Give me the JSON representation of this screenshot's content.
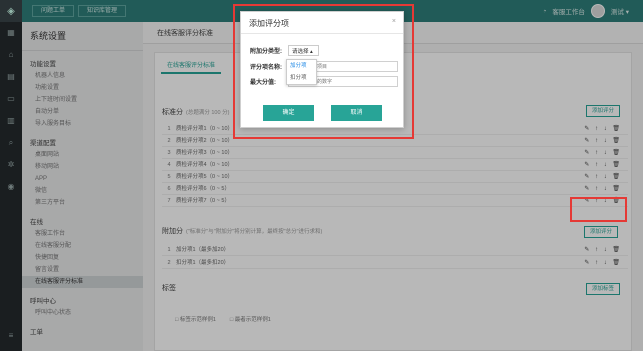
{
  "topbar": {
    "logo_icon": "shield-logo-icon",
    "tabs": [
      "问题工单",
      "知识库管理"
    ],
    "workbench_label": "客服工作台",
    "user_label": "测试 ▾"
  },
  "rail_icons": [
    "grid-icon",
    "home-icon",
    "doc-icon",
    "chat-icon",
    "chart-icon",
    "search-icon",
    "gear-icon",
    "user-icon",
    "list-icon"
  ],
  "sidebar": {
    "title": "系统设置",
    "groups": [
      {
        "label": "功能设置",
        "items": [
          "机器人信息",
          "功能设置",
          "上下班时间设置",
          "自动分单",
          "导入服务目标"
        ]
      },
      {
        "label": "渠道配置",
        "items": [
          "桌面网站",
          "移动网站",
          "APP",
          "微信",
          "第三方平台"
        ]
      },
      {
        "label": "在线",
        "items": [
          "客服工作台",
          "在线客服分配",
          "快捷回复",
          "留言设置",
          "在线客服评分标准"
        ]
      },
      {
        "label": "呼叫中心",
        "items": [
          "呼叫中心状态"
        ]
      },
      {
        "label": "工单",
        "items": []
      }
    ],
    "active_item": "在线客服评分标准"
  },
  "main": {
    "header": "在线客服评分标准",
    "card_tab": "在线客服评分标准",
    "section1": {
      "label": "标准分",
      "sub": "(总题满分 100 分)",
      "add_button": "添加评分"
    },
    "rows1": [
      {
        "n": "1",
        "text": "质检评分项1（0 ~ 10）"
      },
      {
        "n": "2",
        "text": "质检评分项2（0 ~ 10）"
      },
      {
        "n": "3",
        "text": "质检评分项3（0 ~ 10）"
      },
      {
        "n": "4",
        "text": "质检评分项4（0 ~ 10）"
      },
      {
        "n": "5",
        "text": "质检评分项5（0 ~ 10）"
      },
      {
        "n": "6",
        "text": "质检评分项6（0 ~ 5）"
      },
      {
        "n": "7",
        "text": "质检评分项7（0 ~ 5）"
      }
    ],
    "section2": {
      "label": "附加分",
      "note": "(\"标准分\"与\"附加分\"将分别计算，最终按\"总分\"进行求和)",
      "add_button": "添加评分"
    },
    "rows2": [
      {
        "n": "1",
        "text": "加分项1（最多加20）"
      },
      {
        "n": "2",
        "text": "扣分项1（最多扣20）"
      }
    ],
    "section3": {
      "label": "标签",
      "add_button": "添加标签"
    },
    "tags": [
      "□ 标签示范样例1",
      "□ 最者示范样例1"
    ],
    "row_ops": "✎ ↑ ↓ 🗑"
  },
  "modal": {
    "title": "添加评分项",
    "close": "×",
    "type_label": "附加分类型:",
    "type_value": "请选择 ▴",
    "type_options": [
      "加分项",
      "扣分项"
    ],
    "name_label": "评分项名称:",
    "name_placeholder": "请输入评分项目",
    "max_label": "最大分值:",
    "max_placeholder": "请输入正确的数字",
    "ok_button": "确定",
    "cancel_button": "取消"
  },
  "colors": {
    "accent": "#28a497",
    "topbar": "#2f7f7a",
    "highlight": "#e53935"
  }
}
